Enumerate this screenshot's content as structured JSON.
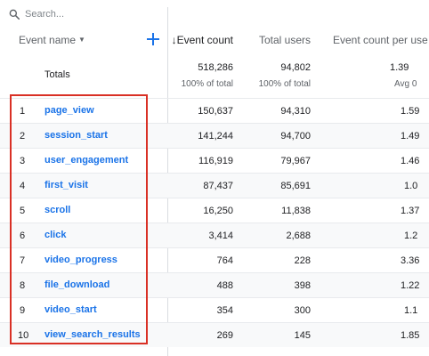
{
  "search": {
    "placeholder": "Search..."
  },
  "header": {
    "event_name": "Event name",
    "event_count": "Event count",
    "total_users": "Total users",
    "event_count_per_user": "Event count per use"
  },
  "totals": {
    "label": "Totals",
    "event_count": "518,286",
    "event_count_sub": "100% of total",
    "total_users": "94,802",
    "total_users_sub": "100% of total",
    "per_user": "1.39",
    "per_user_sub": "Avg 0"
  },
  "rows": [
    {
      "index": "1",
      "name": "page_view",
      "event_count": "150,637",
      "total_users": "94,310",
      "per_user": "1.59"
    },
    {
      "index": "2",
      "name": "session_start",
      "event_count": "141,244",
      "total_users": "94,700",
      "per_user": "1.49"
    },
    {
      "index": "3",
      "name": "user_engagement",
      "event_count": "116,919",
      "total_users": "79,967",
      "per_user": "1.46"
    },
    {
      "index": "4",
      "name": "first_visit",
      "event_count": "87,437",
      "total_users": "85,691",
      "per_user": "1.0"
    },
    {
      "index": "5",
      "name": "scroll",
      "event_count": "16,250",
      "total_users": "11,838",
      "per_user": "1.37"
    },
    {
      "index": "6",
      "name": "click",
      "event_count": "3,414",
      "total_users": "2,688",
      "per_user": "1.2"
    },
    {
      "index": "7",
      "name": "video_progress",
      "event_count": "764",
      "total_users": "228",
      "per_user": "3.36"
    },
    {
      "index": "8",
      "name": "file_download",
      "event_count": "488",
      "total_users": "398",
      "per_user": "1.22"
    },
    {
      "index": "9",
      "name": "video_start",
      "event_count": "354",
      "total_users": "300",
      "per_user": "1.1"
    },
    {
      "index": "10",
      "name": "view_search_results",
      "event_count": "269",
      "total_users": "145",
      "per_user": "1.85"
    }
  ],
  "colors": {
    "link": "#1a73e8",
    "highlight": "#d93025",
    "accent": "#1a73e8"
  }
}
